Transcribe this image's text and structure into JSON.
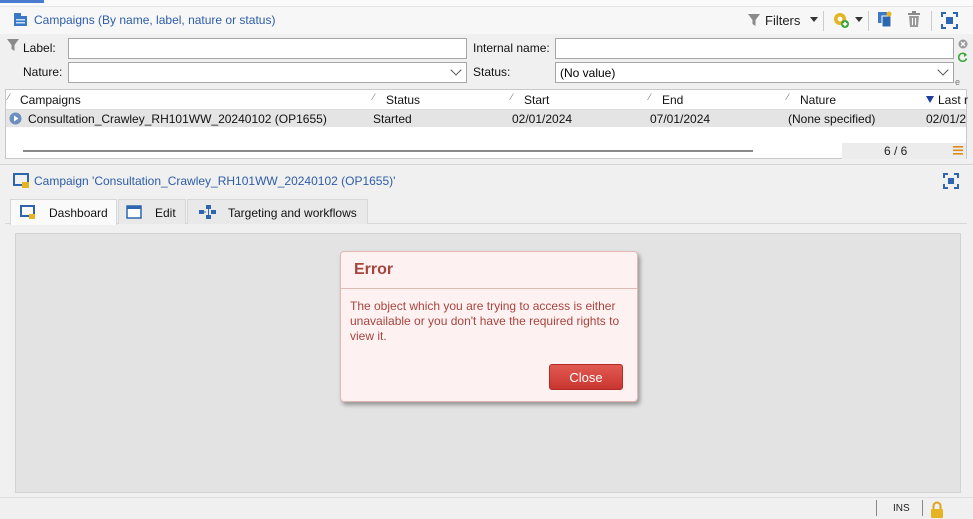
{
  "colors": {
    "accent_blue": "#2d5da8",
    "error_text": "#a8443d",
    "error_bg": "#fdf2f1",
    "close_button": "#d9463f"
  },
  "list": {
    "title": "Campaigns (By name, label, nature or status)",
    "filters_label": "Filters",
    "icons": [
      "campaigns-icon",
      "filter-funnel-icon",
      "new-item-icon",
      "duplicate-icon",
      "delete-icon",
      "maximize-icon"
    ]
  },
  "filter": {
    "label_label": "Label:",
    "label_value": "",
    "internal_name_label": "Internal name:",
    "internal_name_value": "",
    "nature_label": "Nature:",
    "nature_value": "",
    "status_label": "Status:",
    "status_value": "(No value)"
  },
  "grid": {
    "columns": [
      "Campaigns",
      "Status",
      "Start",
      "End",
      "Nature",
      "Last r"
    ],
    "rows": [
      {
        "name": "Consultation_Crawley_RH101WW_20240102 (OP1655)",
        "status": "Started",
        "start": "02/01/2024",
        "end": "07/01/2024",
        "nature": "(None specified)",
        "last": "02/01/2"
      }
    ],
    "count": "6 / 6"
  },
  "detail": {
    "title": "Campaign 'Consultation_Crawley_RH101WW_20240102 (OP1655)'",
    "tabs": [
      "Dashboard",
      "Edit",
      "Targeting and workflows"
    ]
  },
  "dialog": {
    "title": "Error",
    "message": "The object which you are trying to access is either unavailable or you don't have the required rights to view it.",
    "close_label": "Close"
  },
  "statusbar": {
    "mode": "INS"
  }
}
